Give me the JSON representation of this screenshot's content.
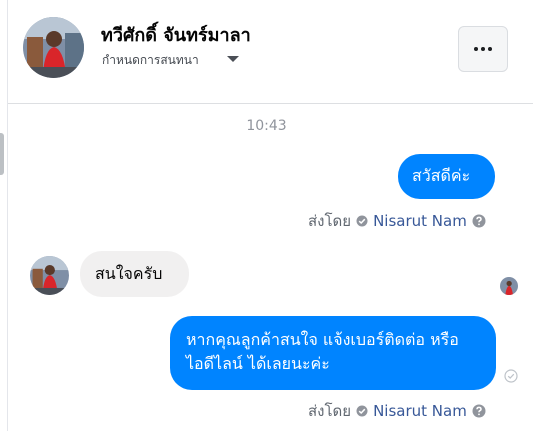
{
  "header": {
    "name": "ทวีศักดิ์ จันทร์มาลา",
    "subtitle": "กำหนดการสนทนา",
    "caret_icon": "caret-down-icon",
    "more_icon": "ellipsis-icon"
  },
  "timestamp": "10:43",
  "messages": [
    {
      "direction": "outgoing",
      "text": "สวัสดีค่ะ"
    },
    {
      "direction": "incoming",
      "text": "สนใจครับ"
    },
    {
      "direction": "outgoing",
      "text": "หากคุณลูกค้าสนใจ แจ้งเบอร์ติดต่อ หรือ ไอดีไลน์ ได้เลยนะค่ะ"
    }
  ],
  "sent_by": {
    "prefix": "ส่งโดย",
    "sender": "Nisarut Nam"
  },
  "colors": {
    "outgoing_bubble": "#0084ff",
    "incoming_bubble": "#f1f0f0",
    "link": "#385898"
  }
}
